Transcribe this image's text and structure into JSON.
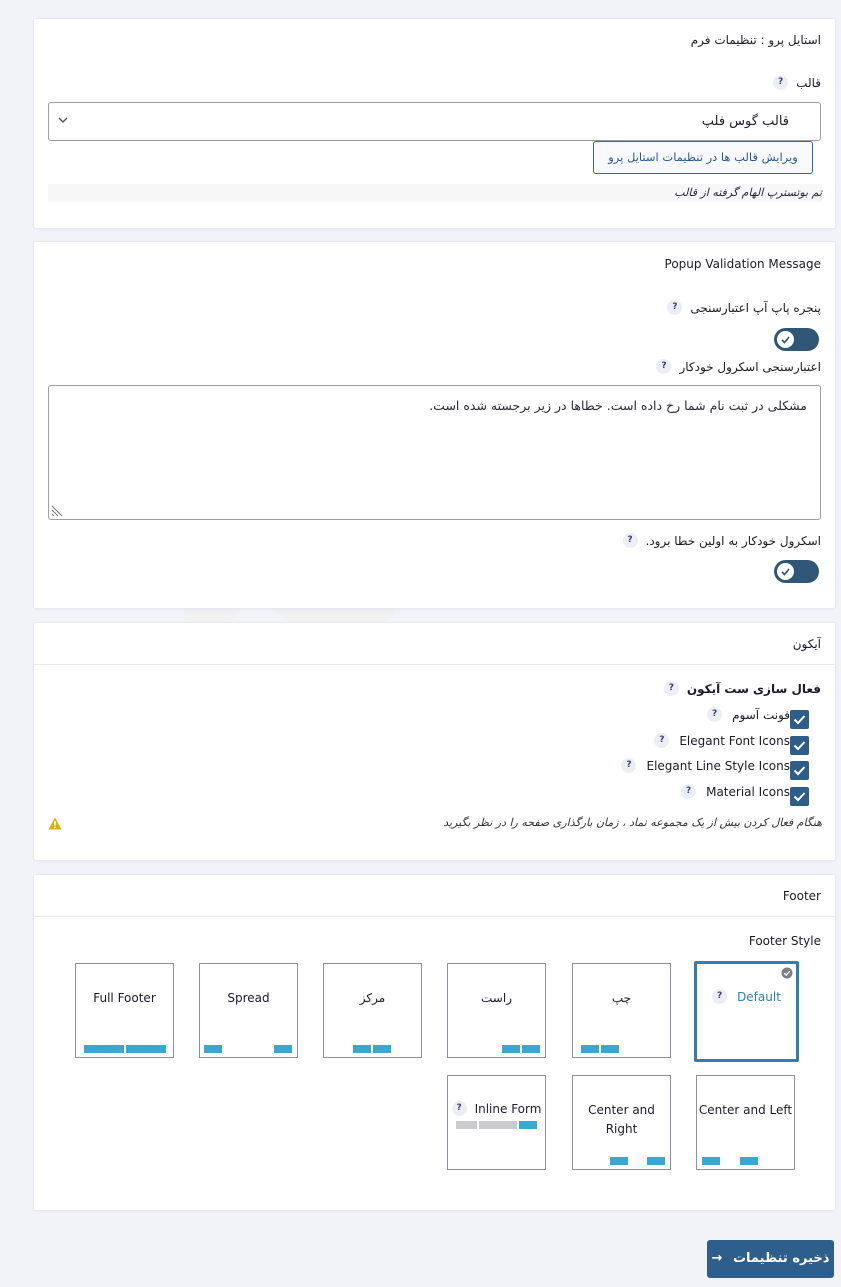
{
  "form_settings": {
    "title": "استایل پرو : تنظیمات فرم",
    "template_label": "قالب",
    "template_value": "قالب گوس فلپ",
    "edit_button": "ویرایش قالب ها در تنظیمات استایل پرو",
    "note": "تم بوتسترپ الهام گرفته از قالب"
  },
  "popup": {
    "title": "Popup Validation Message",
    "popup_label": "پنجره پاپ آپ اعتبارسنجی",
    "scroll_label": "اعتبارسنجی اسکرول خودکار",
    "message": "مشکلی در ثبت نام شما رخ داده است. خطاها در زیر برجسته شده است.",
    "first_error_label": "اسکرول خودکار به اولین خطا برود."
  },
  "icons": {
    "title": "آیکون",
    "enable_label": "فعال سازی ست آیکون",
    "items": [
      {
        "label": "فونت آسوم",
        "checked": true
      },
      {
        "label": "Elegant Font Icons",
        "checked": true
      },
      {
        "label": "Elegant Line Style Icons",
        "checked": true
      },
      {
        "label": "Material Icons",
        "checked": true
      }
    ],
    "warning": "هنگام فعال کردن بیش از یک مجموعه نماد ، زمان بارگذاری صفحه را در نظر بگیرید"
  },
  "footer": {
    "title": "Footer",
    "style_label": "Footer Style",
    "options": [
      {
        "label": "Default",
        "selected": true
      },
      {
        "label": "چپ"
      },
      {
        "label": "راست"
      },
      {
        "label": "مرکز"
      },
      {
        "label": "Spread"
      },
      {
        "label": "Full Footer"
      },
      {
        "label": "Center and Left"
      },
      {
        "label": "Center and Right"
      },
      {
        "label": "Inline Form"
      }
    ]
  },
  "help_symbol": "?",
  "save_button": "ذخیره تنظیمات",
  "save_arrow": "→",
  "colors": {
    "accent": "#2e5e8c",
    "footer_bar": "#39a7cf",
    "selected_border": "#2f7fb6",
    "warning": "#e0b000"
  }
}
